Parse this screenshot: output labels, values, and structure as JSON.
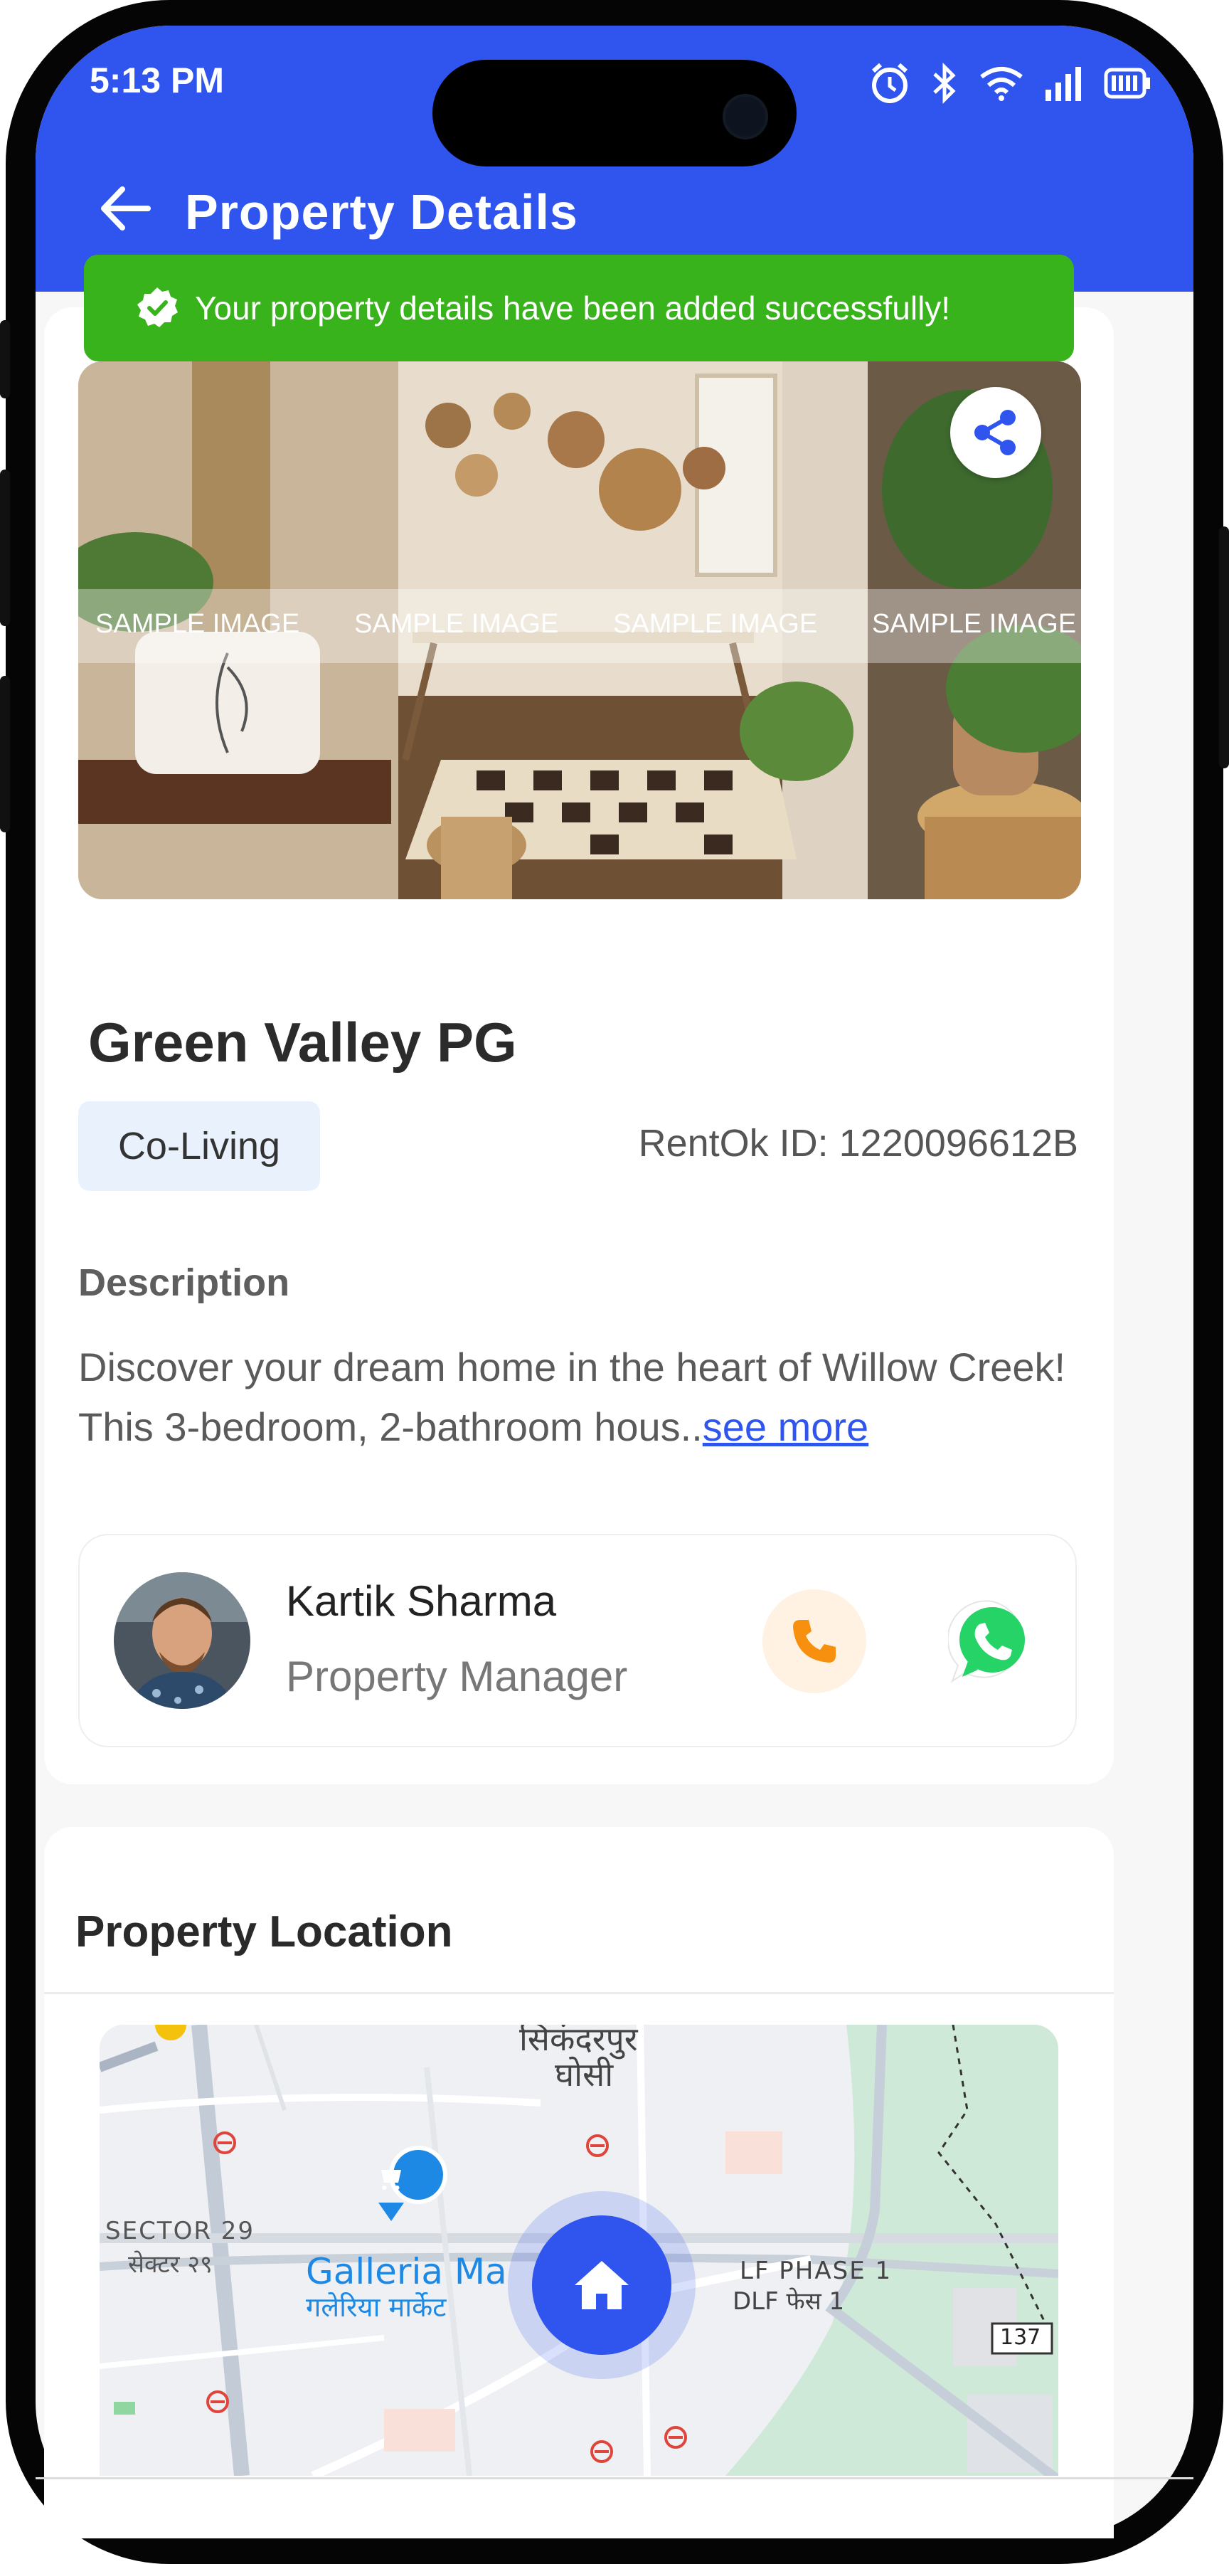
{
  "status_bar": {
    "time": "5:13 PM"
  },
  "header": {
    "title": "Property Details"
  },
  "toast": {
    "message": "Your property details have been added successfully!"
  },
  "hero": {
    "watermark": [
      "SAMPLE IMAGE",
      "SAMPLE IMAGE",
      "SAMPLE IMAGE",
      "SAMPLE IMAGE"
    ]
  },
  "property": {
    "name": "Green Valley PG",
    "type_chip": "Co-Living",
    "rentok_id": "RentOk ID: 1220096612B"
  },
  "description": {
    "heading": "Description",
    "text": "Discover your dream home in the heart of Willow Creek! This 3-bedroom, 2-bathroom hous..",
    "see_more": "see more"
  },
  "manager": {
    "name": "Kartik Sharma",
    "role": "Property Manager"
  },
  "location": {
    "heading": "Property Location",
    "map_labels": {
      "sikandarpur": "सिकंदरपुर",
      "ghosi": "घोसी",
      "sector29": "SECTOR 29",
      "sector29_hi": "सेक्टर २९",
      "galleria": "Galleria Ma",
      "galleria_hi": "गलेरिया मार्केट",
      "dlf1": "LF PHASE 1",
      "dlf1_hi": "DLF फेस 1",
      "road": "137"
    }
  },
  "colors": {
    "primary": "#2f55ee",
    "success": "#39b31c",
    "call_bg": "#fff2e2",
    "whatsapp": "#25d366"
  },
  "icons": [
    "back-arrow-icon",
    "share-icon",
    "check-badge-icon",
    "phone-icon",
    "whatsapp-icon",
    "home-icon",
    "alarm-icon",
    "bluetooth-icon",
    "wifi-icon",
    "signal-icon",
    "battery-icon"
  ]
}
